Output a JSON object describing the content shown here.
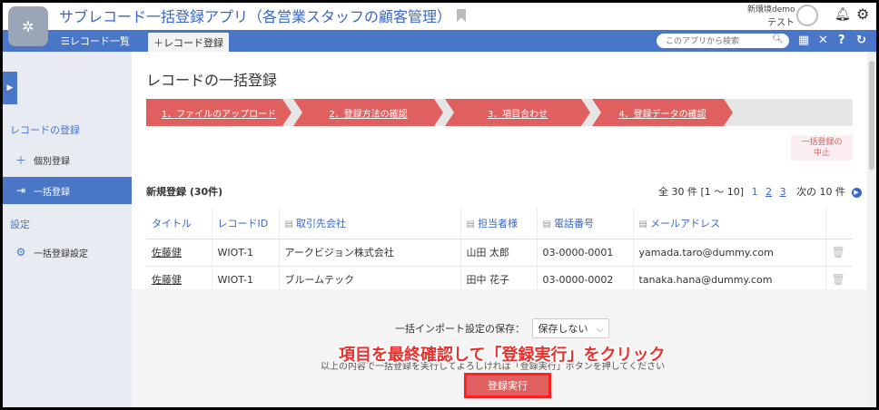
{
  "app": {
    "title": "サブレコード一括登録アプリ（各営業スタッフの顧客管理）",
    "env_label": "新環境demo",
    "user_name": "テスト"
  },
  "toolbar": {
    "tab_list": "☰レコード一覧",
    "tab_add": "＋レコード登録",
    "search_placeholder": "このアプリから検索"
  },
  "sidebar": {
    "section_register": "レコードの登録",
    "item_single": "個別登録",
    "item_bulk": "一括登録",
    "section_settings": "設定",
    "item_bulk_settings": "一括登録設定"
  },
  "main": {
    "title": "レコードの一括登録",
    "steps": [
      "1．ファイルのアップロード",
      "2．登録方法の確認",
      "3．項目合わせ",
      "4．登録データの確認"
    ],
    "cancel_line1": "一括登録の",
    "cancel_line2": "中止",
    "new_count": "新規登録 (30件)",
    "pager_text": "全 30 件 [1 ～ 10]",
    "pages": [
      "1",
      "2",
      "3"
    ],
    "next_label": "次の 10 件",
    "columns": [
      "タイトル",
      "レコードID",
      "取引先会社",
      "担当者様",
      "電話番号",
      "メールアドレス"
    ],
    "rows": [
      [
        "佐藤健",
        "WIOT-1",
        "アークビジョン株式会社",
        "山田 太郎",
        "03-0000-0001",
        "yamada.taro@dummy.com"
      ],
      [
        "佐藤健",
        "WIOT-1",
        "ブルームテック",
        "田中 花子",
        "03-0000-0002",
        "tanaka.hana@dummy.com"
      ]
    ]
  },
  "footer": {
    "save_setting_label": "一括インポート設定の保存：",
    "save_setting_value": "保存しない",
    "confirm_text": "以上の内容で一括登録を実行してよろしければ「登録実行」ボタンを押してください",
    "annotation": "項目を最終確認して「登録実行」をクリック",
    "exec_button": "登録実行"
  },
  "colors": {
    "accent": "#4a76c8",
    "step": "#e06060",
    "annotation": "#e8322f"
  }
}
